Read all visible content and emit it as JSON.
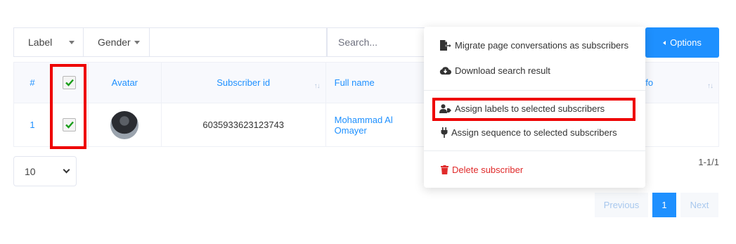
{
  "filters": {
    "label": "Label",
    "gender": "Gender",
    "search_placeholder": "Search..."
  },
  "options_button": "Options",
  "table": {
    "columns": [
      "#",
      "Avatar",
      "Subscriber id",
      "Full name",
      "Quick info"
    ],
    "quick_info_partial": "ck info",
    "rows": [
      {
        "num": "1",
        "subscriber_id": "6035933623123743",
        "full_name": "Mohammad Al Omayer",
        "checked": true
      }
    ]
  },
  "page_size": "10",
  "count": "1-1/1",
  "pager": {
    "previous": "Previous",
    "current": "1",
    "next": "Next"
  },
  "menu": {
    "items": [
      {
        "label": "Migrate page conversations as subscribers",
        "icon": "file-export-icon"
      },
      {
        "label": "Download search result",
        "icon": "cloud-download-icon"
      },
      {
        "label": "Assign labels to selected subscribers",
        "icon": "user-tag-icon"
      },
      {
        "label": "Assign sequence to selected subscribers",
        "icon": "plug-icon"
      },
      {
        "label": "Delete subscriber",
        "icon": "trash-icon"
      }
    ]
  },
  "colors": {
    "accent": "#1e90ff",
    "highlight": "#ee0000",
    "danger": "#e02b2b"
  }
}
